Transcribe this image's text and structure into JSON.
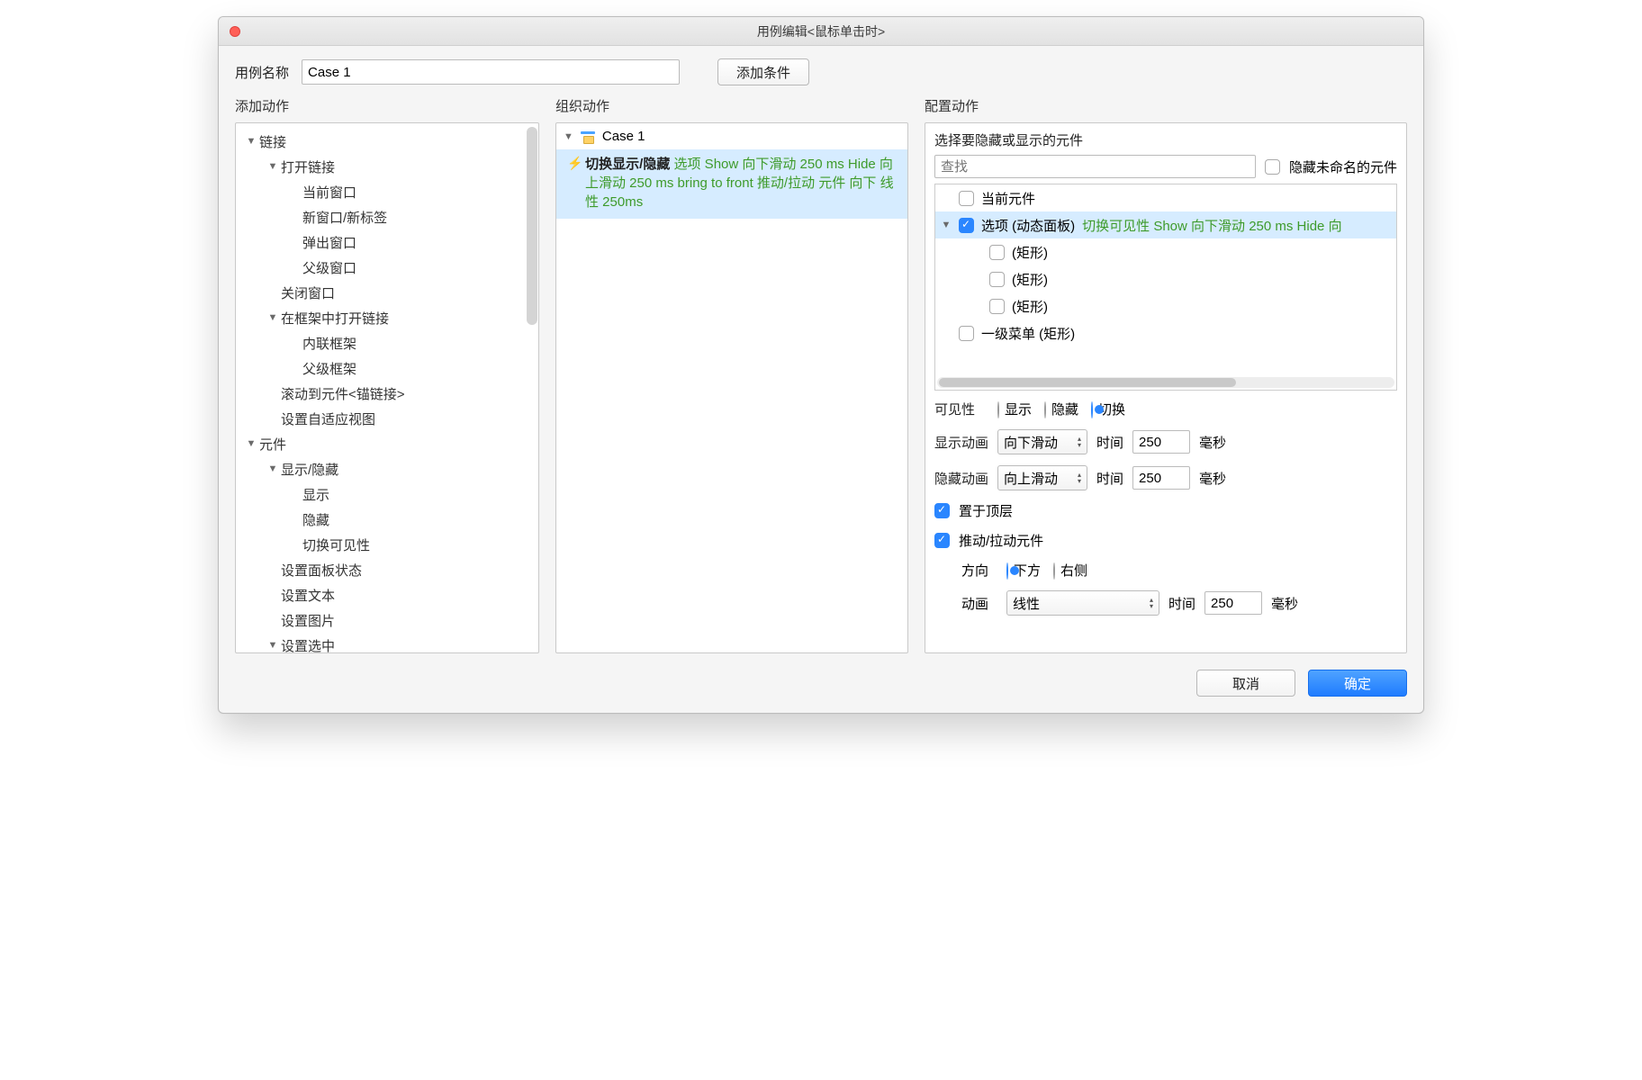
{
  "title": "用例编辑<鼠标单击时>",
  "caseNameLabel": "用例名称",
  "caseNameValue": "Case 1",
  "addConditionBtn": "添加条件",
  "columns": {
    "left": "添加动作",
    "mid": "组织动作",
    "right": "配置动作"
  },
  "actionTree": [
    {
      "indent": 0,
      "arrow": true,
      "label": "链接"
    },
    {
      "indent": 1,
      "arrow": true,
      "label": "打开链接"
    },
    {
      "indent": 2,
      "arrow": false,
      "label": "当前窗口"
    },
    {
      "indent": 2,
      "arrow": false,
      "label": "新窗口/新标签"
    },
    {
      "indent": 2,
      "arrow": false,
      "label": "弹出窗口"
    },
    {
      "indent": 2,
      "arrow": false,
      "label": "父级窗口"
    },
    {
      "indent": 1,
      "arrow": false,
      "label": "关闭窗口"
    },
    {
      "indent": 1,
      "arrow": true,
      "label": "在框架中打开链接"
    },
    {
      "indent": 2,
      "arrow": false,
      "label": "内联框架"
    },
    {
      "indent": 2,
      "arrow": false,
      "label": "父级框架"
    },
    {
      "indent": 1,
      "arrow": false,
      "label": "滚动到元件<锚链接>"
    },
    {
      "indent": 1,
      "arrow": false,
      "label": "设置自适应视图"
    },
    {
      "indent": 0,
      "arrow": true,
      "label": "元件"
    },
    {
      "indent": 1,
      "arrow": true,
      "label": "显示/隐藏"
    },
    {
      "indent": 2,
      "arrow": false,
      "label": "显示"
    },
    {
      "indent": 2,
      "arrow": false,
      "label": "隐藏"
    },
    {
      "indent": 2,
      "arrow": false,
      "label": "切换可见性"
    },
    {
      "indent": 1,
      "arrow": false,
      "label": "设置面板状态"
    },
    {
      "indent": 1,
      "arrow": false,
      "label": "设置文本"
    },
    {
      "indent": 1,
      "arrow": false,
      "label": "设置图片"
    },
    {
      "indent": 1,
      "arrow": true,
      "label": "设置选中"
    }
  ],
  "organize": {
    "caseTitle": "Case 1",
    "actionName": "切换显示/隐藏",
    "actionDesc": "选项 Show 向下滑动 250 ms Hide 向上滑动 250 ms bring to front 推动/拉动 元件 向下 线性 250ms"
  },
  "configHeader": "选择要隐藏或显示的元件",
  "searchPlaceholder": "查找",
  "hideUnnamed": "隐藏未命名的元件",
  "widgets": [
    {
      "indent": 0,
      "arrow": false,
      "checked": false,
      "label": "当前元件",
      "sub": ""
    },
    {
      "indent": 0,
      "arrow": true,
      "checked": true,
      "label": "选项 (动态面板)",
      "sub": "切换可见性 Show 向下滑动 250 ms Hide 向"
    },
    {
      "indent": 1,
      "arrow": false,
      "checked": false,
      "label": "(矩形)",
      "sub": ""
    },
    {
      "indent": 1,
      "arrow": false,
      "checked": false,
      "label": "(矩形)",
      "sub": ""
    },
    {
      "indent": 1,
      "arrow": false,
      "checked": false,
      "label": "(矩形)",
      "sub": ""
    },
    {
      "indent": 0,
      "arrow": false,
      "checked": false,
      "label": "一级菜单 (矩形)",
      "sub": ""
    }
  ],
  "visibility": {
    "label": "可见性",
    "opts": [
      "显示",
      "隐藏",
      "切换"
    ],
    "sel": 2
  },
  "showAnim": {
    "label": "显示动画",
    "value": "向下滑动",
    "timeLabel": "时间",
    "time": "250",
    "unit": "毫秒"
  },
  "hideAnim": {
    "label": "隐藏动画",
    "value": "向上滑动",
    "timeLabel": "时间",
    "time": "250",
    "unit": "毫秒"
  },
  "bringFront": "置于顶层",
  "pushPull": "推动/拉动元件",
  "direction": {
    "label": "方向",
    "opts": [
      "下方",
      "右侧"
    ],
    "sel": 0
  },
  "anim": {
    "label": "动画",
    "value": "线性",
    "timeLabel": "时间",
    "time": "250",
    "unit": "毫秒"
  },
  "cancel": "取消",
  "ok": "确定"
}
